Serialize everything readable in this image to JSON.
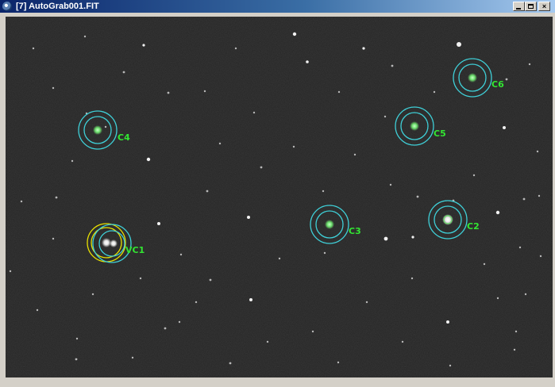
{
  "window": {
    "title": "[7] AutoGrab001.FIT",
    "buttons": {
      "minimize": "_",
      "maximize": "□",
      "close": "×"
    },
    "icon": "app-lens-icon"
  },
  "image": {
    "colors": {
      "background": "#1c1c1c",
      "check_ring": "#3fd0d8",
      "variable_ring": "#e8e000",
      "label": "#32e632"
    },
    "labels": [
      {
        "id": "c4",
        "text": "C4"
      },
      {
        "id": "vc1",
        "text": "VC1"
      },
      {
        "id": "c3",
        "text": "C3"
      },
      {
        "id": "c5",
        "text": "C5"
      },
      {
        "id": "c6",
        "text": "C6"
      },
      {
        "id": "c2",
        "text": "C2"
      }
    ]
  }
}
